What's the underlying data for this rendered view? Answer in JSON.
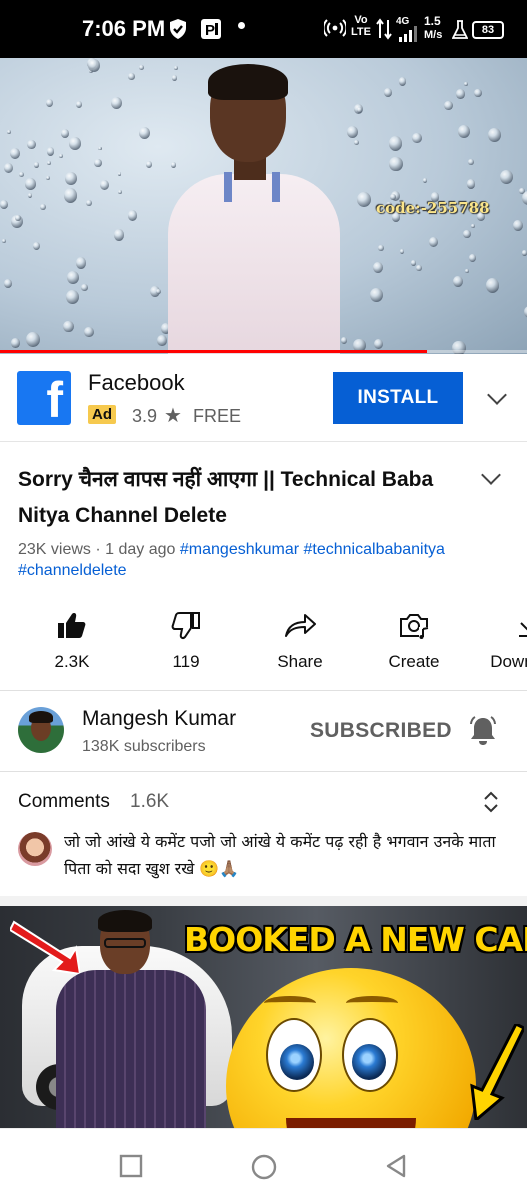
{
  "status_bar": {
    "time": "7:06 PM",
    "network_label": "Vo LTE",
    "network_type": "4G",
    "speed": "1.5",
    "speed_unit": "M/s",
    "battery": "83",
    "icons": [
      "shield-icon",
      "parking-icon",
      "hotspot-icon",
      "data-arrows-icon",
      "signal-icon",
      "flask-icon",
      "battery-icon"
    ]
  },
  "player": {
    "watermark": "code:-255788",
    "progress": 0.81,
    "progress_color": "#ff0000"
  },
  "ad": {
    "app_name": "Facebook",
    "badge": "Ad",
    "rating": "3.9",
    "price": "FREE",
    "install_label": "INSTALL",
    "install_color": "#065fd4"
  },
  "video": {
    "title": "Sorry चैनल वापस नहीं आएगा || Technical Baba Nitya Channel Delete",
    "views": "23K views",
    "age": "1 day ago",
    "tags": [
      "#mangeshkumar",
      "#technicalbabanitya",
      "#channeldelete"
    ]
  },
  "actions": {
    "like": "2.3K",
    "dislike": "119",
    "share": "Share",
    "create": "Create",
    "download": "Download"
  },
  "channel": {
    "name": "Mangesh Kumar",
    "subscribers": "138K subscribers",
    "subscribe_state": "SUBSCRIBED"
  },
  "comments": {
    "label": "Comments",
    "count": "1.6K",
    "top_comment": "जो जो आंखे ये कमेंट पजो जो आंखे ये कमेंट पढ़ रही है भगवान उनके माता पिता को सदा खुश रखे 🙂🙏🏽"
  },
  "next_video": {
    "thumbnail_text": "BOOKED A NEW CAR"
  },
  "accent_colors": {
    "link_blue": "#065fd4",
    "facebook_blue": "#1877f2",
    "ad_badge_yellow": "#f6c94e"
  }
}
